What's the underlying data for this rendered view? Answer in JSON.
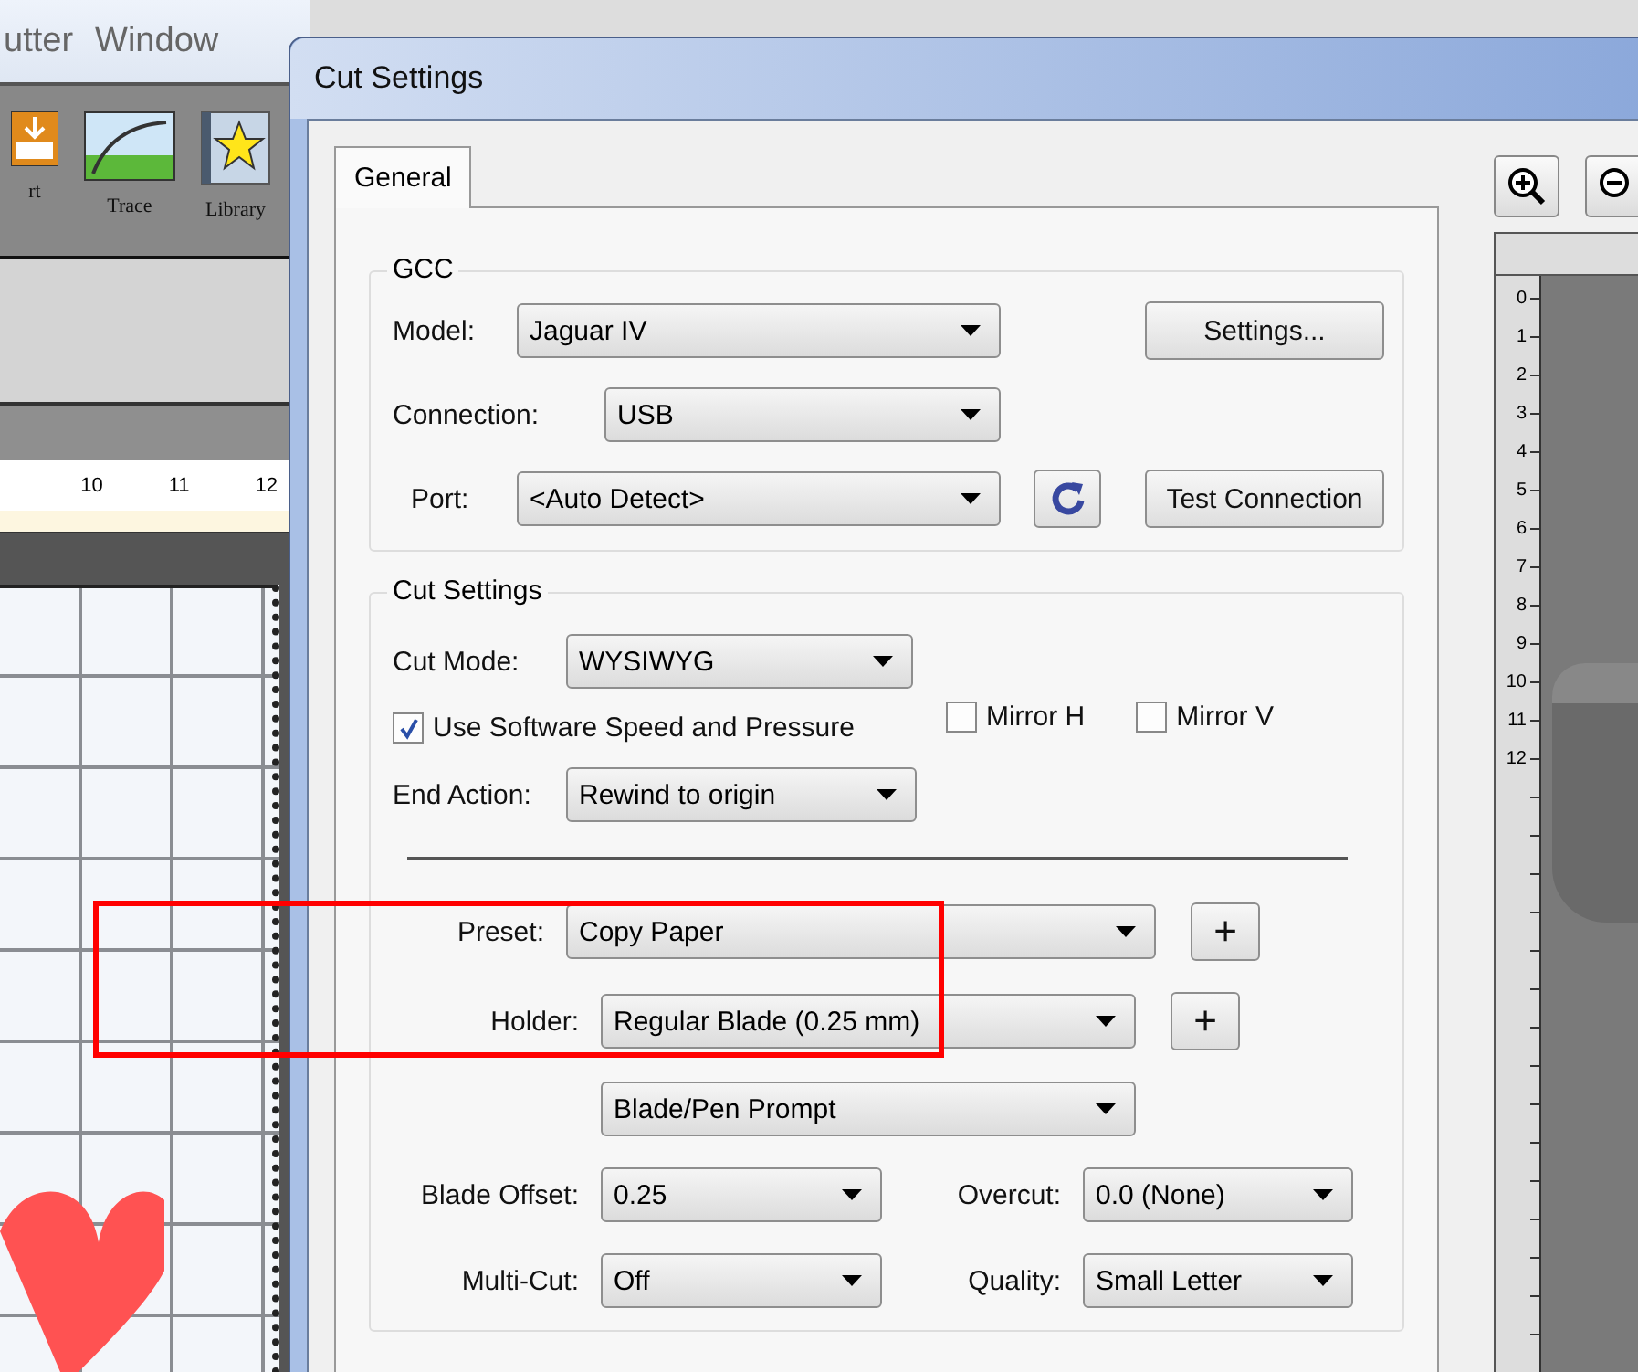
{
  "background_app": {
    "menu": [
      "utter",
      "Window"
    ],
    "toolbar": [
      {
        "label": "rt"
      },
      {
        "label": "Trace"
      },
      {
        "label": "Library"
      }
    ],
    "ruler": [
      "10",
      "11",
      "12"
    ]
  },
  "dialog": {
    "title": "Cut Settings",
    "tabs": [
      {
        "label": "General",
        "selected": true
      }
    ],
    "gcc": {
      "legend": "GCC",
      "model": {
        "label": "Model:",
        "value": "Jaguar IV"
      },
      "settings_button": "Settings...",
      "connection": {
        "label": "Connection:",
        "value": "USB"
      },
      "port": {
        "label": "Port:",
        "value": "<Auto Detect>"
      },
      "test_button": "Test Connection"
    },
    "cut_settings": {
      "legend": "Cut Settings",
      "cut_mode": {
        "label": "Cut Mode:",
        "value": "WYSIWYG"
      },
      "use_software": {
        "label": "Use Software Speed and Pressure",
        "checked": true
      },
      "mirror_h": {
        "label": "Mirror H",
        "checked": false
      },
      "mirror_v": {
        "label": "Mirror V",
        "checked": false
      },
      "end_action": {
        "label": "End Action:",
        "value": "Rewind to origin"
      },
      "preset": {
        "label": "Preset:",
        "value": "Copy Paper",
        "add": "+"
      },
      "holder": {
        "label": "Holder:",
        "value": "Regular Blade (0.25 mm)",
        "add": "+"
      },
      "prompt": {
        "value": "Blade/Pen Prompt"
      },
      "blade_offset": {
        "label": "Blade Offset:",
        "value": "0.25"
      },
      "overcut": {
        "label": "Overcut:",
        "value": "0.0 (None)"
      },
      "multi_cut": {
        "label": "Multi-Cut:",
        "value": "Off"
      },
      "quality": {
        "label": "Quality:",
        "value": "Small Letter"
      }
    },
    "preview": {
      "ruler": [
        "0",
        "1",
        "2",
        "3",
        "4",
        "5",
        "6",
        "7",
        "8",
        "9",
        "10",
        "11",
        "12"
      ]
    }
  }
}
